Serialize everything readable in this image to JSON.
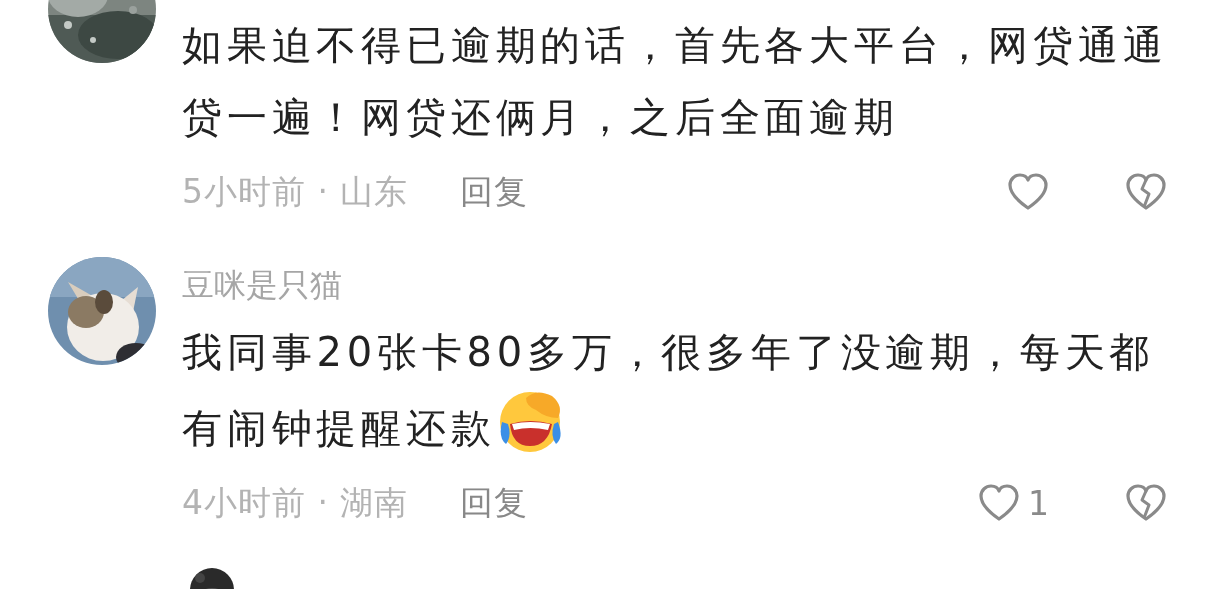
{
  "comments": [
    {
      "text": "如果迫不得已逾期的话，首先各大平台，网贷通通贷一遍！网贷还俩月，之后全面逾期",
      "time": "5小时前 · 山东",
      "reply": "回复",
      "liked": false,
      "disliked": false
    },
    {
      "username": "豆咪是只猫",
      "text": "我同事20张卡80多万，很多年了没逾期，每天都有闹钟提醒还款",
      "has_emoji": true,
      "time": "4小时前 · 湖南",
      "reply": "回复",
      "like_count": "1",
      "liked": false,
      "disliked": false
    }
  ]
}
